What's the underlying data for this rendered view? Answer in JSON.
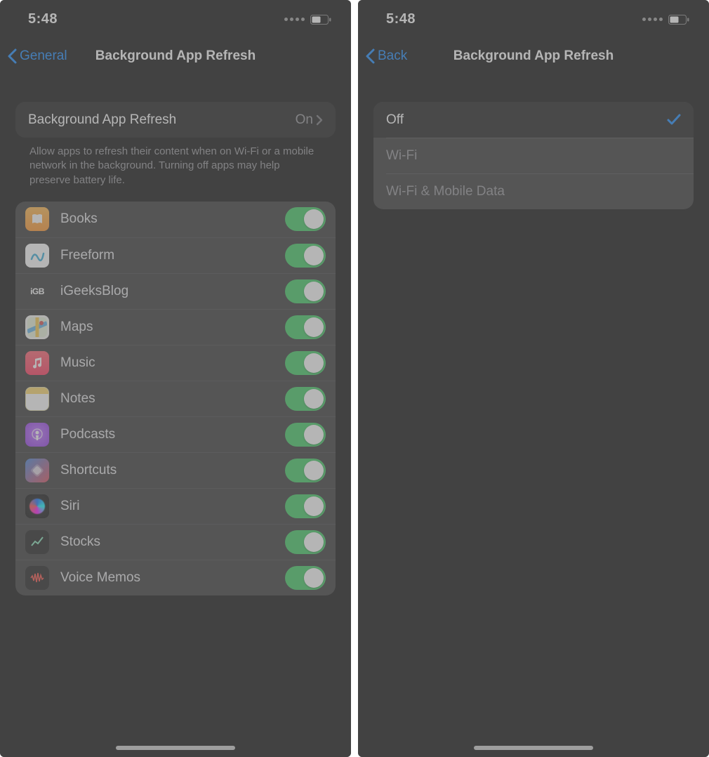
{
  "left": {
    "status_time": "5:48",
    "back_label": "General",
    "title": "Background App Refresh",
    "main_cell": {
      "label": "Background App Refresh",
      "value": "On"
    },
    "description": "Allow apps to refresh their content when on Wi-Fi or a mobile network in the background. Turning off apps may help preserve battery life.",
    "apps": [
      {
        "name": "Books",
        "icon": "books"
      },
      {
        "name": "Freeform",
        "icon": "freeform"
      },
      {
        "name": "iGeeksBlog",
        "icon": "igb"
      },
      {
        "name": "Maps",
        "icon": "maps"
      },
      {
        "name": "Music",
        "icon": "music"
      },
      {
        "name": "Notes",
        "icon": "notes"
      },
      {
        "name": "Podcasts",
        "icon": "podcasts"
      },
      {
        "name": "Shortcuts",
        "icon": "shortcuts"
      },
      {
        "name": "Siri",
        "icon": "siri"
      },
      {
        "name": "Stocks",
        "icon": "stocks"
      },
      {
        "name": "Voice Memos",
        "icon": "voice"
      }
    ],
    "igb_text": "iGB"
  },
  "right": {
    "status_time": "5:48",
    "back_label": "Back",
    "title": "Background App Refresh",
    "options": [
      {
        "label": "Off",
        "selected": true
      },
      {
        "label": "Wi-Fi",
        "selected": false
      },
      {
        "label": "Wi-Fi & Mobile Data",
        "selected": false
      }
    ]
  }
}
